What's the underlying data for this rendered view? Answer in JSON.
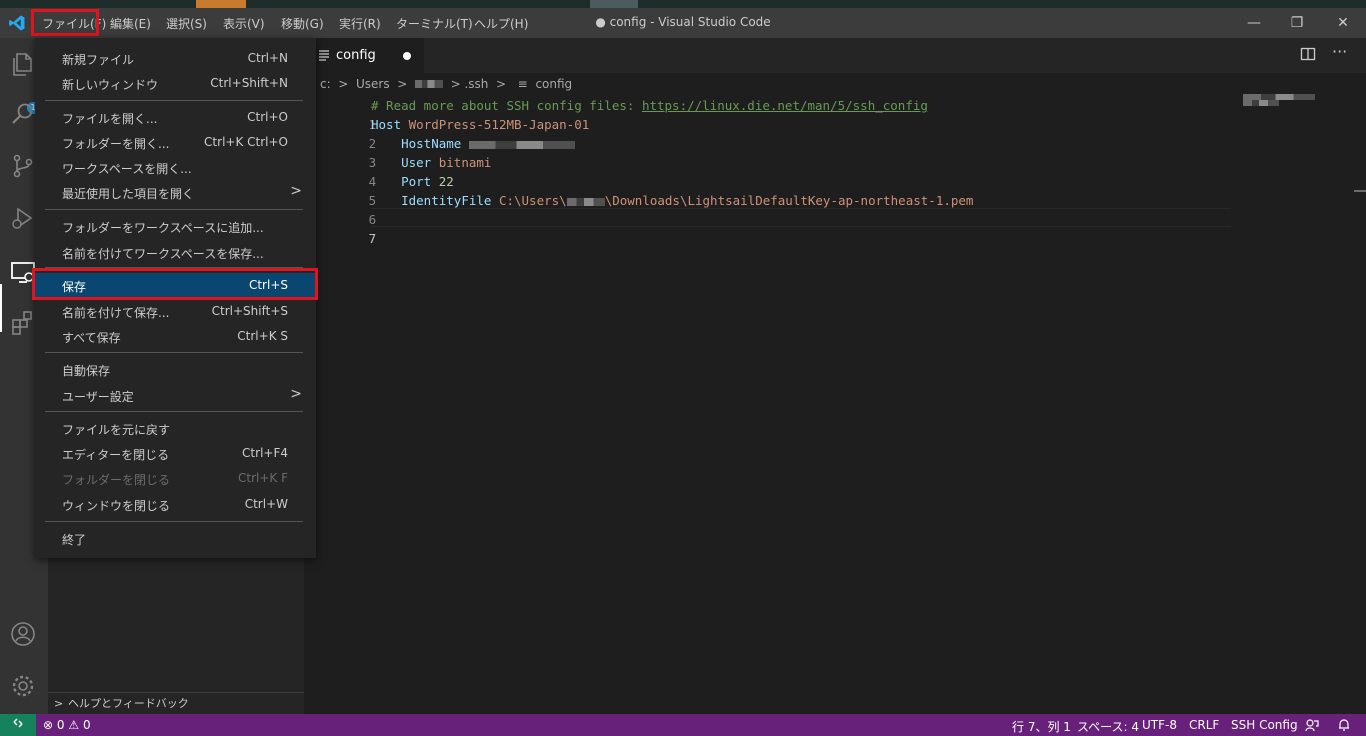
{
  "menubar": {
    "items": [
      "ファイル(F)",
      "編集(E)",
      "選択(S)",
      "表示(V)",
      "移動(G)",
      "実行(R)",
      "ターミナル(T)",
      "ヘルプ(H)"
    ],
    "window_title": "● config - Visual Studio Code",
    "window_controls": {
      "minimize": "—",
      "restore": "❐",
      "close": "✕"
    }
  },
  "activitybar": {
    "explorer_badge": "1",
    "icons": [
      "files-icon",
      "search-icon",
      "source-control-icon",
      "run-debug-icon",
      "remote-explorer-icon",
      "extensions-icon",
      "account-icon",
      "settings-gear-icon"
    ]
  },
  "sidebar": {
    "section_label": "ヘルプとフィードバック"
  },
  "tab": {
    "label": "config",
    "modified": true
  },
  "breadcrumb": {
    "drive": "c:",
    "users": "Users",
    "ssh": ".ssh",
    "file": "config"
  },
  "editor": {
    "line_numbers": [
      "1",
      "2",
      "3",
      "4",
      "5",
      "6",
      "7"
    ],
    "line1": {
      "comment": "# Read more about SSH config files: ",
      "link": "https://linux.die.net/man/5/ssh_config"
    },
    "line2": {
      "key": "Host",
      "value": "WordPress-512MB-Japan-01"
    },
    "line3": {
      "key": "HostName"
    },
    "line4": {
      "key": "User",
      "value": "bitnami"
    },
    "line5": {
      "key": "Port",
      "value": "22"
    },
    "line6": {
      "key": "IdentityFile",
      "value_prefix": "C:\\Users\\",
      "value_suffix": "\\Downloads\\LightsailDefaultKey-ap-northeast-1.pem"
    }
  },
  "file_menu": {
    "items": [
      {
        "label": "新規ファイル",
        "shortcut": "Ctrl+N"
      },
      {
        "label": "新しいウィンドウ",
        "shortcut": "Ctrl+Shift+N"
      },
      {
        "label": "ファイルを開く...",
        "shortcut": "Ctrl+O"
      },
      {
        "label": "フォルダーを開く...",
        "shortcut": "Ctrl+K Ctrl+O"
      },
      {
        "label": "ワークスペースを開く...",
        "shortcut": ""
      },
      {
        "label": "最近使用した項目を開く",
        "shortcut": "",
        "submenu": true
      },
      {
        "label": "フォルダーをワークスペースに追加...",
        "shortcut": ""
      },
      {
        "label": "名前を付けてワークスペースを保存...",
        "shortcut": ""
      },
      {
        "label": "保存",
        "shortcut": "Ctrl+S",
        "selected": true
      },
      {
        "label": "名前を付けて保存...",
        "shortcut": "Ctrl+Shift+S"
      },
      {
        "label": "すべて保存",
        "shortcut": "Ctrl+K S"
      },
      {
        "label": "自動保存",
        "shortcut": ""
      },
      {
        "label": "ユーザー設定",
        "shortcut": "",
        "submenu": true
      },
      {
        "label": "ファイルを元に戻す",
        "shortcut": ""
      },
      {
        "label": "エディターを閉じる",
        "shortcut": "Ctrl+F4"
      },
      {
        "label": "フォルダーを閉じる",
        "shortcut": "Ctrl+K F",
        "disabled": true
      },
      {
        "label": "ウィンドウを閉じる",
        "shortcut": "Ctrl+W"
      },
      {
        "label": "終了",
        "shortcut": ""
      }
    ]
  },
  "statusbar": {
    "errors": "0",
    "warnings": "0",
    "position": "行 7、列 1",
    "spaces": "スペース: 4",
    "encoding": "UTF-8",
    "eol": "CRLF",
    "language": "SSH Config"
  },
  "colors": {
    "accent_statusbar": "#68217a",
    "remote_indicator": "#16825d",
    "highlight_box": "#e0141e",
    "menu_selected": "#094771"
  }
}
